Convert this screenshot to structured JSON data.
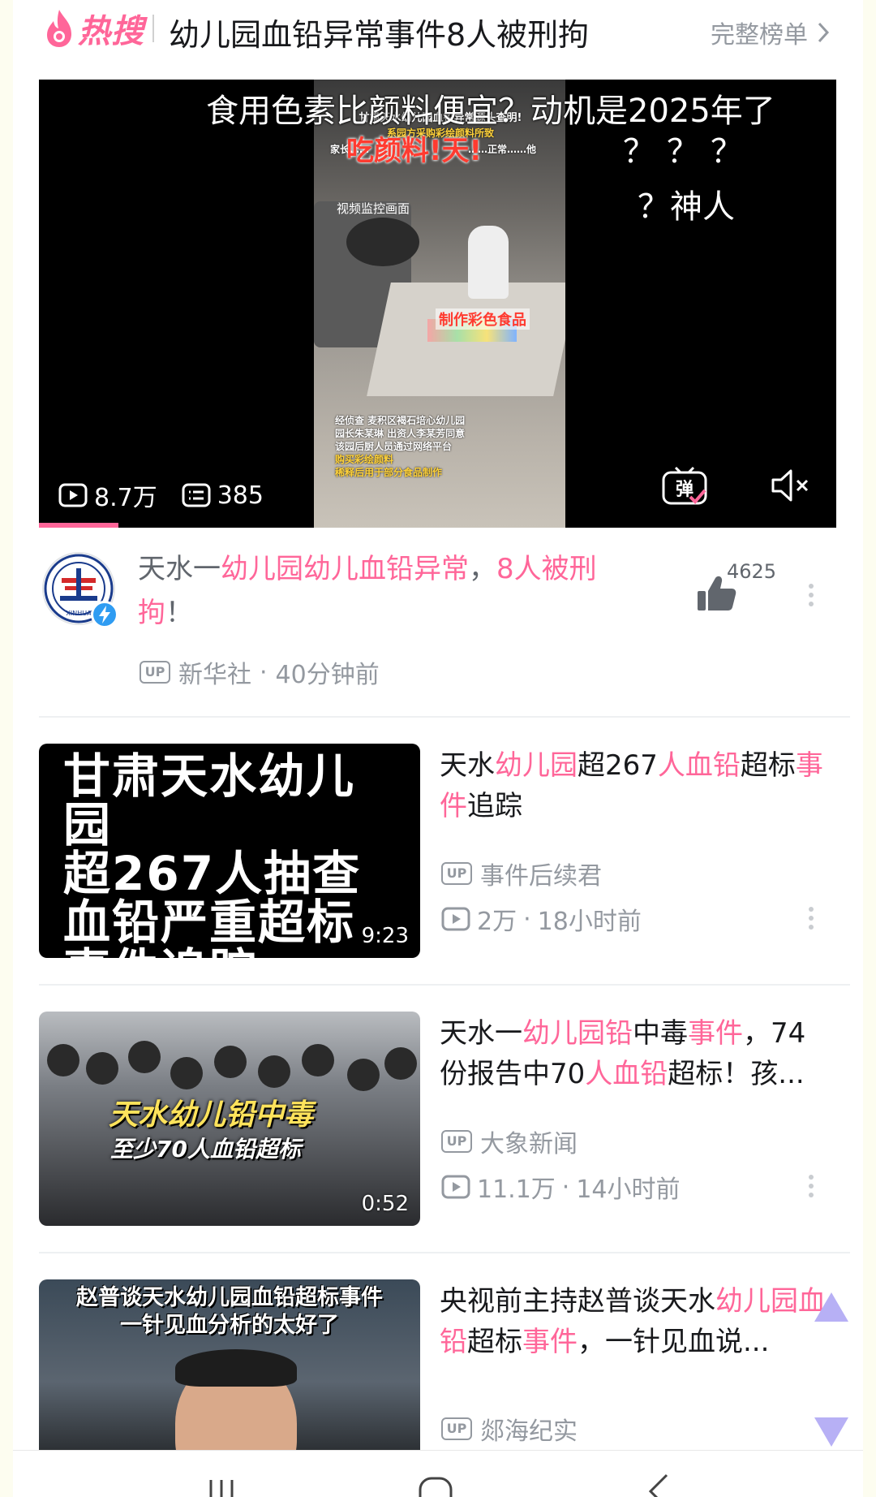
{
  "header": {
    "logo_text": "热搜",
    "title": "幼儿园血铅异常事件8人被刑拘",
    "full_list_label": "完整榜单"
  },
  "video": {
    "frame": {
      "header_line": "甘肃天水幼儿园血铅异常源头查明!",
      "sub_line": "系园方采购彩绘颜料所致",
      "side_line": "家长……",
      "side_line_right": "……正常……他",
      "big_text": "吃颜料!天!",
      "caption": "视频监控画面",
      "tag": "制作彩色食品",
      "info_lines": [
        {
          "text": "经侦查 麦积区褐石培心幼儿园",
          "highlight": false
        },
        {
          "text": "园长朱某琳 出资人李某芳同意",
          "highlight": false
        },
        {
          "text": "该园后厨人员通过网络平台",
          "highlight": false
        },
        {
          "text": "购买彩绘颜料",
          "highlight": true
        },
        {
          "text": "稀释后用于部分食品制作",
          "highlight": true
        }
      ]
    },
    "danmaku": [
      "食用色素比颜料便宜？动机是2025年了",
      "？？？",
      "？神人"
    ],
    "play_count": "8.7万",
    "danmaku_count": "385",
    "progress": 0.1
  },
  "featured": {
    "title_parts": [
      {
        "text": "天水一",
        "kw": false
      },
      {
        "text": "幼儿园幼儿血铅异常",
        "kw": true
      },
      {
        "text": "，",
        "kw": false
      },
      {
        "text": "8人被刑拘",
        "kw": true
      },
      {
        "text": "！",
        "kw": false
      }
    ],
    "like_count": "4625",
    "avatar_label": "XINHUA",
    "up_badge": "UP",
    "author": "新华社",
    "time": "40分钟前"
  },
  "items": [
    {
      "thumb_lines": [
        "甘肃天水幼儿园",
        "超267人抽查",
        "血铅严重超标",
        "事件追踪"
      ],
      "duration": "9:23",
      "title_parts": [
        {
          "text": "天水",
          "kw": false
        },
        {
          "text": "幼儿园",
          "kw": true
        },
        {
          "text": "超267",
          "kw": false
        },
        {
          "text": "人血铅",
          "kw": true
        },
        {
          "text": "超标",
          "kw": false
        },
        {
          "text": "事件",
          "kw": true
        },
        {
          "text": "追踪",
          "kw": false
        }
      ],
      "author": "事件后续君",
      "plays": "2万",
      "time": "18小时前"
    },
    {
      "thumb_big": "天水幼儿铅中毒",
      "thumb_sub": "至少70人血铅超标",
      "duration": "0:52",
      "title_parts": [
        {
          "text": "天水一",
          "kw": false
        },
        {
          "text": "幼儿园铅",
          "kw": true
        },
        {
          "text": "中毒",
          "kw": false
        },
        {
          "text": "事件",
          "kw": true
        },
        {
          "text": "，74份报告中70",
          "kw": false
        },
        {
          "text": "人血铅",
          "kw": true
        },
        {
          "text": "超标！孩...",
          "kw": false
        }
      ],
      "author": "大象新闻",
      "plays": "11.1万",
      "time": "14小时前"
    },
    {
      "thumb_caption": [
        "赵普谈天水幼儿园血铅超标事件",
        "一针见血分析的太好了"
      ],
      "title_parts": [
        {
          "text": "央视前主持赵普谈天水",
          "kw": false
        },
        {
          "text": "幼儿园",
          "kw": true
        },
        {
          "text": "血铅",
          "kw": true
        },
        {
          "text": "超标",
          "kw": false
        },
        {
          "text": "事件",
          "kw": true
        },
        {
          "text": "，一针见血说...",
          "kw": false
        }
      ],
      "author": "郯海纪实"
    }
  ],
  "colors": {
    "accent": "#ff6699",
    "muted": "#9499a0",
    "text": "#18191c",
    "scroll_arrow": "#b7b0f5"
  }
}
